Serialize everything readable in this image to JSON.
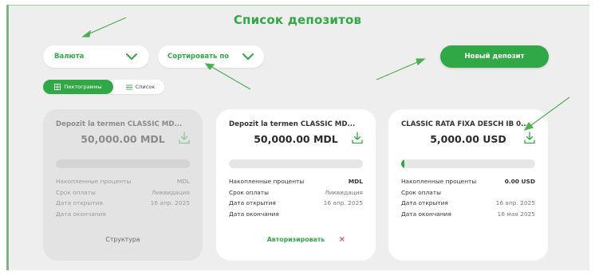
{
  "page": {
    "title": "Список депозитов"
  },
  "filters": {
    "currency_label": "Валюта",
    "sort_label": "Сортировать по",
    "new_deposit_label": "Новый депозит"
  },
  "view_toggle": {
    "icons_label": "Пиктограммы",
    "list_label": "Список",
    "active": "Пиктограммы"
  },
  "cards": [
    {
      "name": "Depozit la termen CLASSIC MD...",
      "amount": "50,000.00 MDL",
      "progress": 0,
      "rows": [
        {
          "label": "Накопленные проценты",
          "value": "MDL"
        },
        {
          "label": "Срок оплаты",
          "value": "Ликвидация"
        },
        {
          "label": "Дата открытия",
          "value": "16 апр. 2025"
        },
        {
          "label": "Дата окончания",
          "value": ""
        }
      ],
      "footer": "Структура",
      "state": "inactive"
    },
    {
      "name": "Depozit la termen CLASSIC MD...",
      "amount": "50,000.00 MDL",
      "progress": 0,
      "rows": [
        {
          "label": "Накопленные проценты",
          "value": "MDL"
        },
        {
          "label": "Срок оплаты",
          "value": "Ликвидация"
        },
        {
          "label": "Дата открытия",
          "value": "16 апр. 2025"
        },
        {
          "label": "Дата окончания",
          "value": ""
        }
      ],
      "footer": "Авторизировать",
      "cancel": "×",
      "state": "pending"
    },
    {
      "name": "CLASSIC RATA FIXA DESCH IB 0...",
      "amount": "5,000.00 USD",
      "progress": 0.01,
      "rows": [
        {
          "label": "Накопленные проценты",
          "value": "0.00 USD"
        },
        {
          "label": "Срок оплаты",
          "value": ""
        },
        {
          "label": "Дата открытия",
          "value": "16 апр. 2025"
        },
        {
          "label": "Дата окончания",
          "value": "16 мая 2025"
        }
      ],
      "state": "active"
    }
  ],
  "colors": {
    "accent": "#2fa845",
    "background": "#eeeeee",
    "cancel": "#e44a4a",
    "annotation_arrow": "#4caf50"
  },
  "icons": [
    "chevron-down-icon",
    "download-icon",
    "grid-icon",
    "list-icon",
    "annotation-arrow"
  ]
}
